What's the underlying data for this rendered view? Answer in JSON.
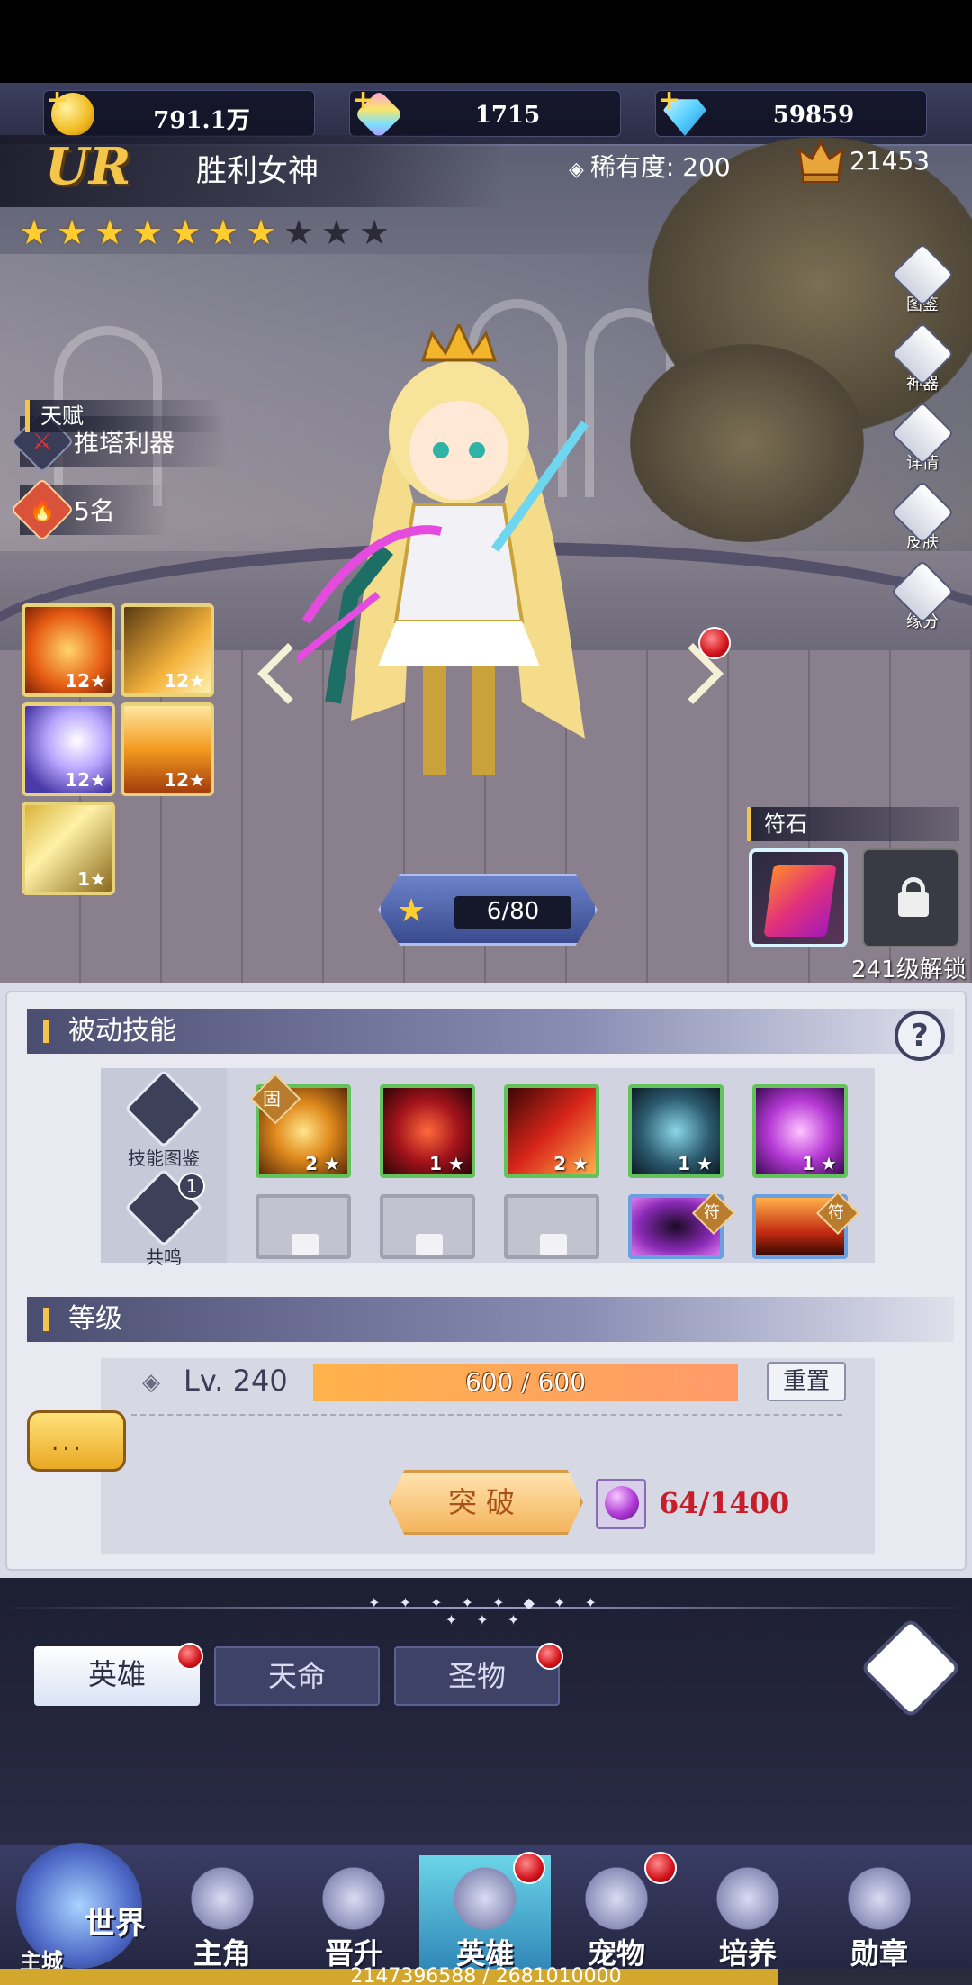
{
  "resources": [
    {
      "name": "gold",
      "value": "791.1万"
    },
    {
      "name": "crystal",
      "value": "1715"
    },
    {
      "name": "diamond",
      "value": "59859"
    }
  ],
  "hero": {
    "grade": "UR",
    "name": "胜利女神",
    "rarity_label": "稀有度:",
    "rarity_value": "200",
    "power": "21453",
    "stars_filled": 7,
    "stars_total": 10,
    "tag_role": "推塔利器",
    "tag_rank": "5名",
    "talent_title": "天赋",
    "talents": [
      {
        "level": "12"
      },
      {
        "level": "12"
      },
      {
        "level": "12"
      },
      {
        "level": "12"
      },
      {
        "level": "1"
      }
    ],
    "star_level": "6/80"
  },
  "side_menu": [
    "图鉴",
    "神器",
    "详情",
    "皮肤",
    "缘分"
  ],
  "rune": {
    "title": "符石",
    "unlock_text": "241级解锁"
  },
  "passive": {
    "title": "被动技能",
    "help": "?",
    "codex_label": "技能图鉴",
    "resonance_label": "共鸣",
    "resonance_count": "1",
    "skills_top": [
      {
        "level": "2",
        "badge": "固"
      },
      {
        "level": "1",
        "badge": ""
      },
      {
        "level": "2",
        "badge": ""
      },
      {
        "level": "1",
        "badge": ""
      },
      {
        "level": "1",
        "badge": ""
      }
    ],
    "skills_bottom_badges": [
      "符",
      "符"
    ]
  },
  "level": {
    "title": "等级",
    "lv_text": "Lv. 240",
    "exp_text": "600 / 600",
    "exp_fraction": 1.0,
    "reset_label": "重置",
    "chat_dots": "...",
    "breakthrough_label": "突破",
    "cost_text": "64/1400"
  },
  "tabs": [
    {
      "label": "英雄",
      "active": true,
      "dot": true
    },
    {
      "label": "天命",
      "active": false,
      "dot": false
    },
    {
      "label": "圣物",
      "active": false,
      "dot": true
    }
  ],
  "divider_stars": "✦ ✦ ✦ ✦ ✦ ◆ ✦ ✦ ✦ ✦ ✦",
  "nav": {
    "world_title": "世界",
    "world_sub": "主城",
    "items": [
      {
        "label": "主角",
        "active": false,
        "dot": false
      },
      {
        "label": "晋升",
        "active": false,
        "dot": false
      },
      {
        "label": "英雄",
        "active": true,
        "dot": true
      },
      {
        "label": "宠物",
        "active": false,
        "dot": true
      },
      {
        "label": "培养",
        "active": false,
        "dot": false
      },
      {
        "label": "勋章",
        "active": false,
        "dot": false
      }
    ]
  },
  "footer_progress": {
    "text": "2147396588 / 2681010000",
    "fraction": 0.801
  },
  "colors": {
    "accent": "#f3c54a",
    "red_dot": "#d1121b",
    "skill_border": "#63c35a"
  }
}
